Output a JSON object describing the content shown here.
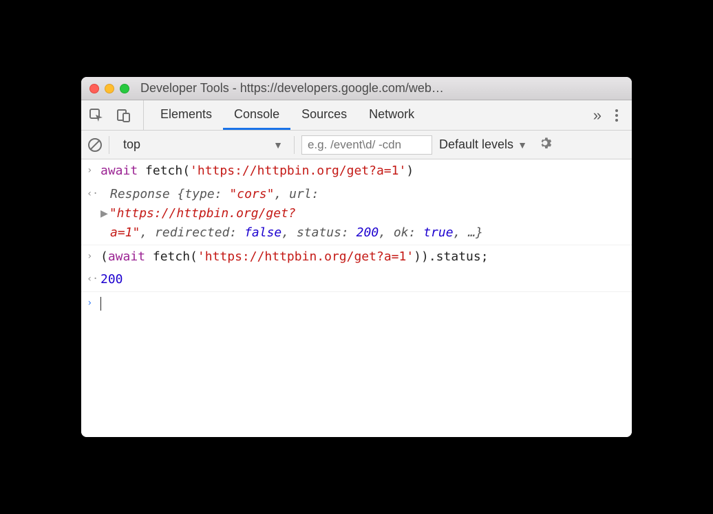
{
  "window": {
    "title": "Developer Tools - https://developers.google.com/web…"
  },
  "tabs": {
    "elements": "Elements",
    "console": "Console",
    "sources": "Sources",
    "network": "Network"
  },
  "filterbar": {
    "context": "top",
    "filter_placeholder": "e.g. /event\\d/ -cdn",
    "levels": "Default levels"
  },
  "console": {
    "line1": {
      "kw": "await",
      "fn": " fetch(",
      "str": "'https://httpbin.org/get?a=1'",
      "close": ")"
    },
    "resp1": {
      "prefix": "Response {",
      "type_k": "type: ",
      "type_v": "\"cors\"",
      "url_k": ", url: ",
      "url_v1": "\"https://httpbin.org/get?",
      "url_v2": "a=1\"",
      "redir_k": ", redirected: ",
      "redir_v": "false",
      "status_k": ", status: ",
      "status_v": "200",
      "ok_k": ", ok: ",
      "ok_v": "true",
      "suffix": ", …}"
    },
    "line2": {
      "open": "(",
      "kw": "await",
      "fn": " fetch(",
      "str": "'https://httpbin.org/get?a=1'",
      "close": ")).status;"
    },
    "resp2": "200"
  }
}
